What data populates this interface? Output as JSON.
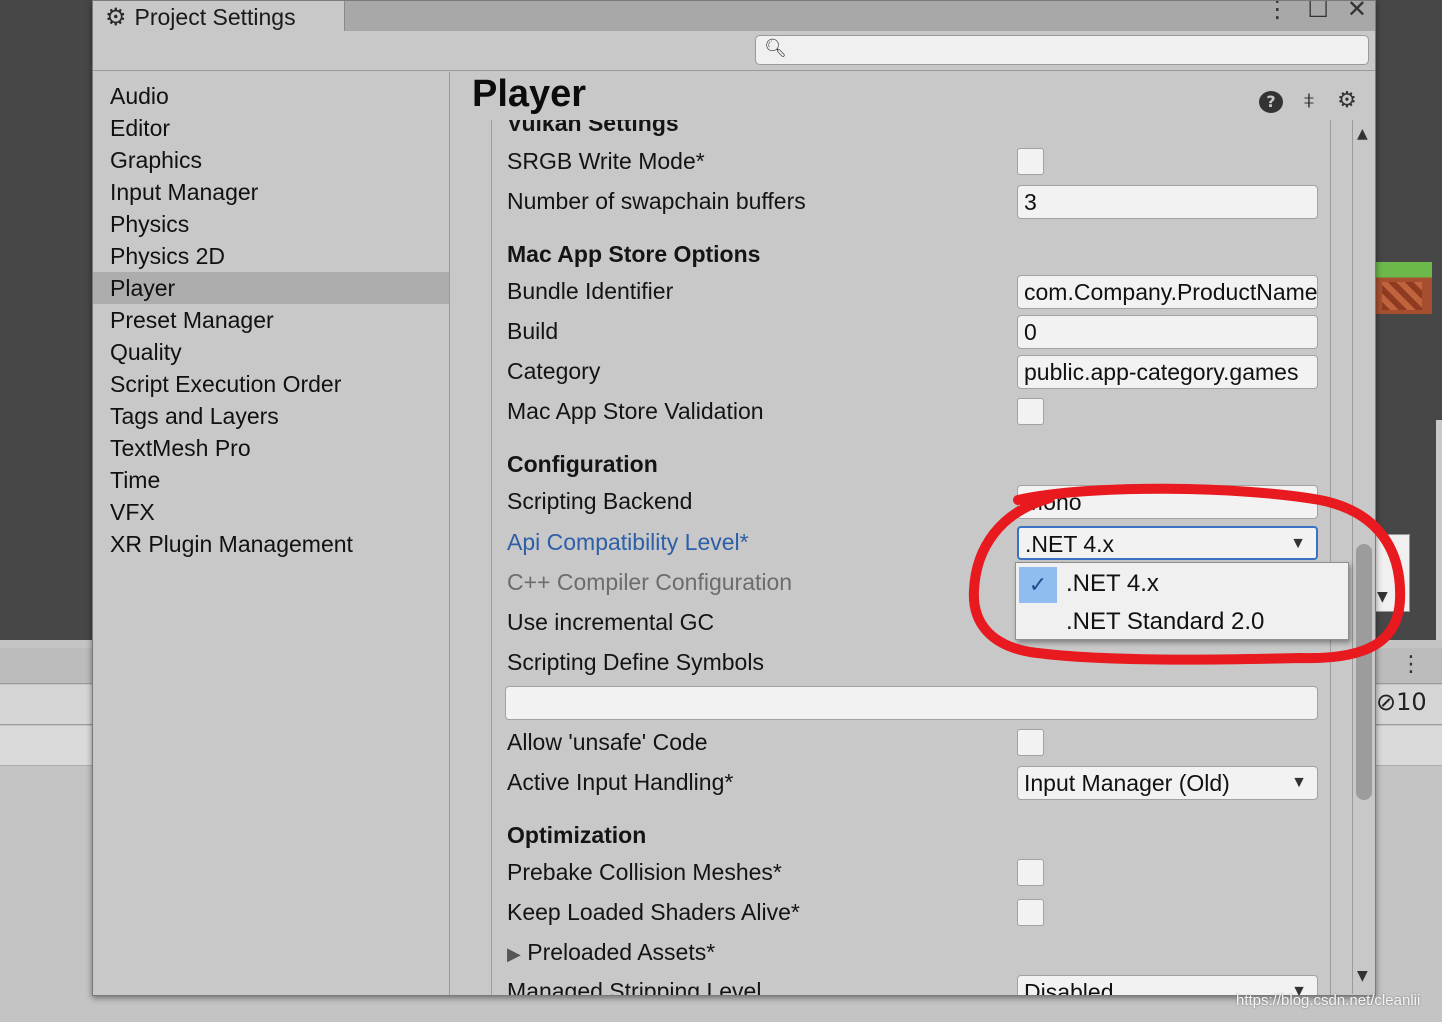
{
  "window": {
    "title": "Project Settings",
    "search_placeholder": ""
  },
  "sidebar": {
    "items": [
      {
        "label": "Audio"
      },
      {
        "label": "Editor"
      },
      {
        "label": "Graphics"
      },
      {
        "label": "Input Manager"
      },
      {
        "label": "Physics"
      },
      {
        "label": "Physics 2D"
      },
      {
        "label": "Player",
        "active": true
      },
      {
        "label": "Preset Manager"
      },
      {
        "label": "Quality"
      },
      {
        "label": "Script Execution Order"
      },
      {
        "label": "Tags and Layers"
      },
      {
        "label": "TextMesh Pro"
      },
      {
        "label": "Time"
      },
      {
        "label": "VFX"
      },
      {
        "label": "XR Plugin Management"
      }
    ]
  },
  "main": {
    "title": "Player",
    "vulkan": {
      "heading": "Vulkan Settings",
      "srgb_label": "SRGB Write Mode*",
      "swapchain_label": "Number of swapchain buffers",
      "swapchain_value": "3"
    },
    "mac": {
      "heading": "Mac App Store Options",
      "bundle_label": "Bundle Identifier",
      "bundle_value": "com.Company.ProductName",
      "build_label": "Build",
      "build_value": "0",
      "category_label": "Category",
      "category_value": "public.app-category.games",
      "validation_label": "Mac App Store Validation"
    },
    "config": {
      "heading": "Configuration",
      "backend_label": "Scripting Backend",
      "backend_value": "Mono",
      "api_label": "Api Compatibility Level*",
      "api_value": ".NET 4.x",
      "cpp_label": "C++ Compiler Configuration",
      "gc_label": "Use incremental GC",
      "define_label": "Scripting Define Symbols",
      "define_value": "",
      "unsafe_label": "Allow 'unsafe' Code",
      "input_label": "Active Input Handling*",
      "input_value": "Input Manager (Old)"
    },
    "optimization": {
      "heading": "Optimization",
      "prebake_label": "Prebake Collision Meshes*",
      "shaders_label": "Keep Loaded Shaders Alive*",
      "preloaded_label": "Preloaded Assets*",
      "stripping_label": "Managed Stripping Level",
      "stripping_value": "Disabled"
    }
  },
  "api_popup": {
    "options": [
      {
        "label": ".NET 4.x",
        "selected": true
      },
      {
        "label": ".NET Standard 2.0",
        "selected": false
      }
    ]
  },
  "background": {
    "count": "10",
    "watermark": "https://blog.csdn.net/cleanlii"
  },
  "colors": {
    "annotation_red": "#e8191f",
    "highlight_blue": "#2d5fa8",
    "focus_border": "#3a72c4",
    "selected_check_bg": "#8fbdf0"
  }
}
